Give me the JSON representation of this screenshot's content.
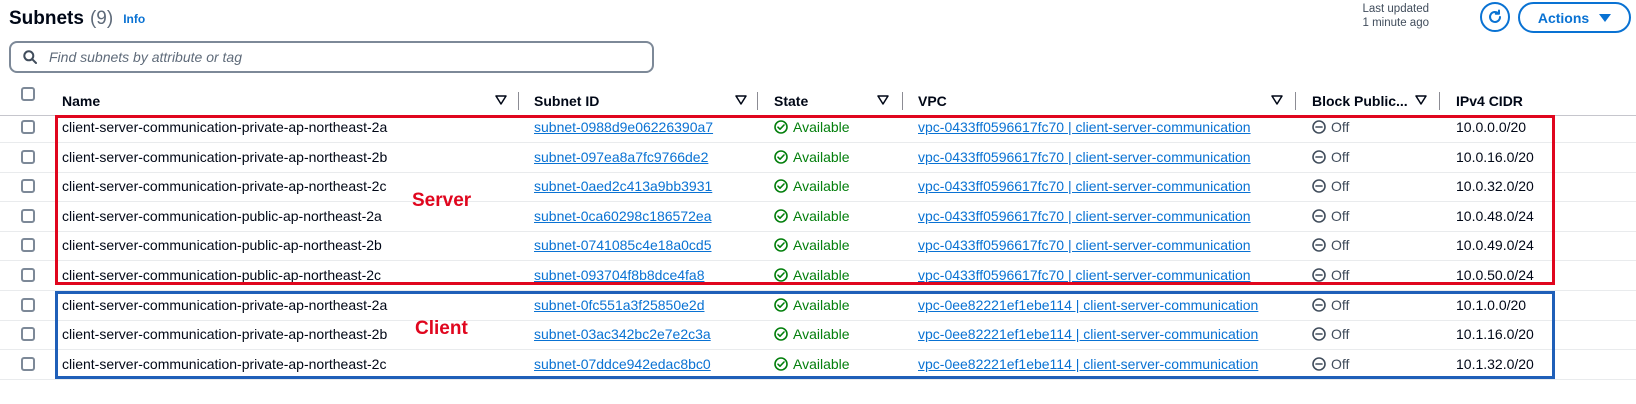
{
  "header": {
    "title": "Subnets",
    "count": "(9)",
    "info": "Info"
  },
  "last_updated": {
    "line1": "Last updated",
    "line2": "1 minute ago"
  },
  "actions": {
    "label": "Actions"
  },
  "search": {
    "placeholder": "Find subnets by attribute or tag"
  },
  "columns": [
    "Name",
    "Subnet ID",
    "State",
    "VPC",
    "Block Public...",
    "IPv4 CIDR"
  ],
  "rows": [
    {
      "name": "client-server-communication-private-ap-northeast-2a",
      "subnet_id": "subnet-0988d9e06226390a7",
      "state": "Available",
      "vpc": "vpc-0433ff0596617fc70 | client-server-communication",
      "block": "Off",
      "cidr": "10.0.0.0/20"
    },
    {
      "name": "client-server-communication-private-ap-northeast-2b",
      "subnet_id": "subnet-097ea8a7fc9766de2",
      "state": "Available",
      "vpc": "vpc-0433ff0596617fc70 | client-server-communication",
      "block": "Off",
      "cidr": "10.0.16.0/20"
    },
    {
      "name": "client-server-communication-private-ap-northeast-2c",
      "subnet_id": "subnet-0aed2c413a9bb3931",
      "state": "Available",
      "vpc": "vpc-0433ff0596617fc70 | client-server-communication",
      "block": "Off",
      "cidr": "10.0.32.0/20"
    },
    {
      "name": "client-server-communication-public-ap-northeast-2a",
      "subnet_id": "subnet-0ca60298c186572ea",
      "state": "Available",
      "vpc": "vpc-0433ff0596617fc70 | client-server-communication",
      "block": "Off",
      "cidr": "10.0.48.0/24"
    },
    {
      "name": "client-server-communication-public-ap-northeast-2b",
      "subnet_id": "subnet-0741085c4e18a0cd5",
      "state": "Available",
      "vpc": "vpc-0433ff0596617fc70 | client-server-communication",
      "block": "Off",
      "cidr": "10.0.49.0/24"
    },
    {
      "name": "client-server-communication-public-ap-northeast-2c",
      "subnet_id": "subnet-093704f8b8dce4fa8",
      "state": "Available",
      "vpc": "vpc-0433ff0596617fc70 | client-server-communication",
      "block": "Off",
      "cidr": "10.0.50.0/24"
    },
    {
      "name": "client-server-communication-private-ap-northeast-2a",
      "subnet_id": "subnet-0fc551a3f25850e2d",
      "state": "Available",
      "vpc": "vpc-0ee82221ef1ebe114 | client-server-communication",
      "block": "Off",
      "cidr": "10.1.0.0/20"
    },
    {
      "name": "client-server-communication-private-ap-northeast-2b",
      "subnet_id": "subnet-03ac342bc2e7e2c3a",
      "state": "Available",
      "vpc": "vpc-0ee82221ef1ebe114 | client-server-communication",
      "block": "Off",
      "cidr": "10.1.16.0/20"
    },
    {
      "name": "client-server-communication-private-ap-northeast-2c",
      "subnet_id": "subnet-07ddce942edac8bc0",
      "state": "Available",
      "vpc": "vpc-0ee82221ef1ebe114 | client-server-communication",
      "block": "Off",
      "cidr": "10.1.32.0/20"
    }
  ],
  "annotations": {
    "server": "Server",
    "client": "Client"
  },
  "colors": {
    "accent": "#0972d3",
    "success": "#037f0c",
    "server_box": "#e0061e",
    "client_box": "#1f5fb8"
  },
  "icons": {
    "search": "search-icon",
    "refresh": "refresh-icon",
    "sort": "caret-down-outline-icon",
    "available": "status-check-icon",
    "off": "status-off-icon"
  }
}
